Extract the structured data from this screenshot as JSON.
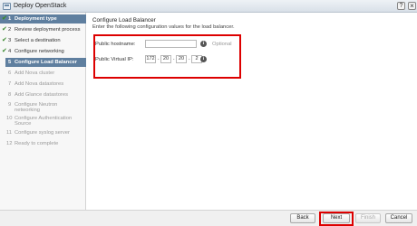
{
  "window": {
    "title": "Deploy OpenStack",
    "help_label": "?",
    "close_label": "×"
  },
  "sidebar": {
    "steps": [
      {
        "num": "1",
        "label": "Deployment type",
        "state": "done-active"
      },
      {
        "num": "2",
        "label": "Review deployment process",
        "state": "done"
      },
      {
        "num": "3",
        "label": "Select a destination",
        "state": "done"
      },
      {
        "num": "4",
        "label": "Configure networking",
        "state": "done"
      },
      {
        "num": "5",
        "label": "Configure Load Balancer",
        "state": "active"
      },
      {
        "num": "6",
        "label": "Add Nova cluster",
        "state": "future"
      },
      {
        "num": "7",
        "label": "Add Nova datastores",
        "state": "future"
      },
      {
        "num": "8",
        "label": "Add Glance datastores",
        "state": "future"
      },
      {
        "num": "9",
        "label": "Configure Neutron networking",
        "state": "future"
      },
      {
        "num": "10",
        "label": "Configure Authentication Source",
        "state": "future"
      },
      {
        "num": "11",
        "label": "Configure syslog server",
        "state": "future"
      },
      {
        "num": "12",
        "label": "Ready to complete",
        "state": "future"
      }
    ],
    "checkmark": "✔"
  },
  "main": {
    "heading": "Configure Load Balancer",
    "subheading": "Enter the following configuration values for the load balancer.",
    "form": {
      "hostname_label": "Public hostname:",
      "hostname_value": "",
      "optional_label": "Optional",
      "vip_label": "Public Virtual IP:",
      "vip_octets": [
        "172",
        "20",
        "20",
        "2"
      ]
    },
    "info_icon_glyph": "i"
  },
  "footer": {
    "back_label": "Back",
    "next_label": "Next",
    "finish_label": "Finish",
    "cancel_label": "Cancel"
  },
  "colors": {
    "active_step_bg": "#5f7f9f",
    "highlight_red": "#dd0000",
    "check_green": "#3a8a2e"
  }
}
